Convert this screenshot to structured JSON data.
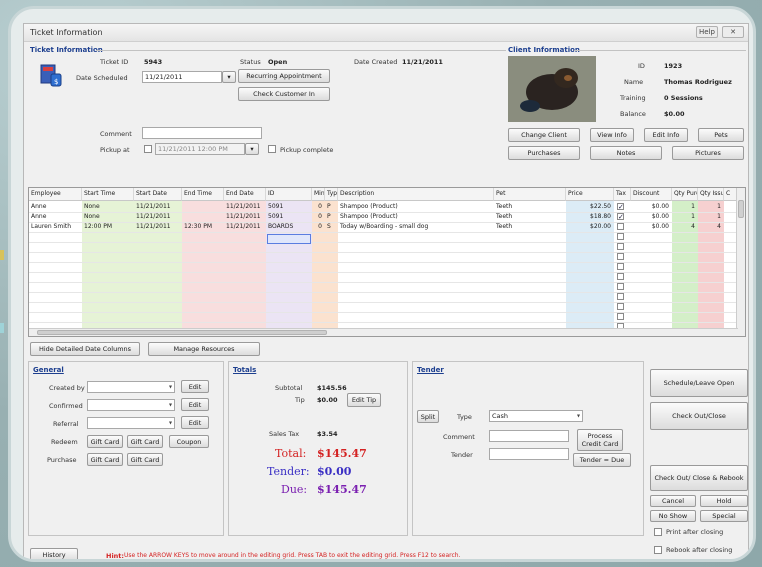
{
  "window": {
    "title": "Ticket Information",
    "help_label": "Help",
    "close_label": "✕"
  },
  "ticket": {
    "group_title": "Ticket Information",
    "ticket_id_label": "Ticket ID",
    "ticket_id": "5943",
    "status_label": "Status",
    "status": "Open",
    "date_created_label": "Date Created",
    "date_created": "11/21/2011",
    "date_scheduled_label": "Date Scheduled",
    "date_scheduled": "11/21/2011",
    "recurring_button": "Recurring Appointment",
    "check_customer_button": "Check Customer In",
    "comment_label": "Comment",
    "comment": "",
    "pickup_label": "Pickup at",
    "pickup_value": "11/21/2011 12:00 PM",
    "pickup_complete_label": "Pickup complete"
  },
  "client": {
    "group_title": "Client Information",
    "id_label": "ID",
    "id": "1923",
    "name_label": "Name",
    "name": "Thomas Rodriguez",
    "training_label": "Training",
    "training": "0 Sessions",
    "balance_label": "Balance",
    "balance": "$0.00",
    "buttons": {
      "change_client": "Change Client",
      "view_info": "View Info",
      "edit_info": "Edit Info",
      "pets": "Pets",
      "purchases": "Purchases",
      "notes": "Notes",
      "pictures": "Pictures"
    }
  },
  "grid": {
    "headers": [
      "Employee",
      "Start Time",
      "Start Date",
      "End Time",
      "End Date",
      "ID",
      "Mins",
      "Type",
      "Description",
      "Pet",
      "Price",
      "Tax",
      "Discount",
      "Qty Purch",
      "Qty Issued",
      "C"
    ],
    "rows": [
      [
        "Anne",
        "None",
        "11/21/2011",
        "",
        "11/21/2011",
        "5091",
        "0",
        "P",
        "Shampoo (Product)",
        "Teeth",
        "$22.50",
        "✓",
        "$0.00",
        "1",
        "1",
        ""
      ],
      [
        "Anne",
        "None",
        "11/21/2011",
        "",
        "11/21/2011",
        "5091",
        "0",
        "P",
        "Shampoo (Product)",
        "Teeth",
        "$18.80",
        "✓",
        "$0.00",
        "1",
        "1",
        ""
      ],
      [
        "Lauren Smith",
        "12:00 PM",
        "11/21/2011",
        "12:30 PM",
        "11/21/2011",
        "BOARDS",
        "0",
        "S",
        "Today w/Boarding - small dog",
        "Teeth",
        "$20.00",
        "",
        "$0.00",
        "4",
        "4",
        ""
      ]
    ]
  },
  "grid_buttons": {
    "hide_columns": "Hide Detailed Date Columns",
    "manage_resources": "Manage Resources"
  },
  "general": {
    "title": "General",
    "created_by_label": "Created by",
    "confirmed_label": "Confirmed",
    "referral_label": "Referral",
    "redeem_label": "Redeem",
    "purchase_label": "Purchase",
    "edit_label": "Edit",
    "gift_card_label": "Gift Card",
    "coupon_label": "Coupon"
  },
  "totals": {
    "title": "Totals",
    "subtotal_label": "Subtotal",
    "subtotal": "$145.56",
    "tip_label": "Tip",
    "tip": "$0.00",
    "edit_tip": "Edit Tip",
    "sales_tax_label": "Sales Tax",
    "sales_tax": "$3.54",
    "total_label": "Total:",
    "total": "$145.47",
    "tender_label": "Tender:",
    "tender": "$0.00",
    "due_label": "Due:",
    "due": "$145.47",
    "colors": {
      "total": "#d42222",
      "tender": "#3a2fc4",
      "due": "#7a1fb0"
    }
  },
  "tender": {
    "title": "Tender",
    "split_label": "Split",
    "type_label": "Type",
    "type_value": "Cash",
    "comment_label": "Comment",
    "tender_label": "Tender",
    "process_credit": "Process Credit Card",
    "tender_due": "Tender = Due"
  },
  "actions": {
    "schedule_leave_open": "Schedule/Leave Open",
    "check_out_close": "Check Out/Close",
    "check_out_close_rebook": "Check Out/ Close & Rebook",
    "cancel": "Cancel",
    "hold": "Hold",
    "no_show": "No Show",
    "special": "Special",
    "print_after_closing": "Print after closing",
    "rebook_after_closing": "Rebook after closing"
  },
  "footer": {
    "history": "History",
    "hint_prefix": "Hint:",
    "hint": "Use the ARROW KEYS to move around in the editing grid. Press TAB to exit the editing grid. Press F12 to search."
  }
}
